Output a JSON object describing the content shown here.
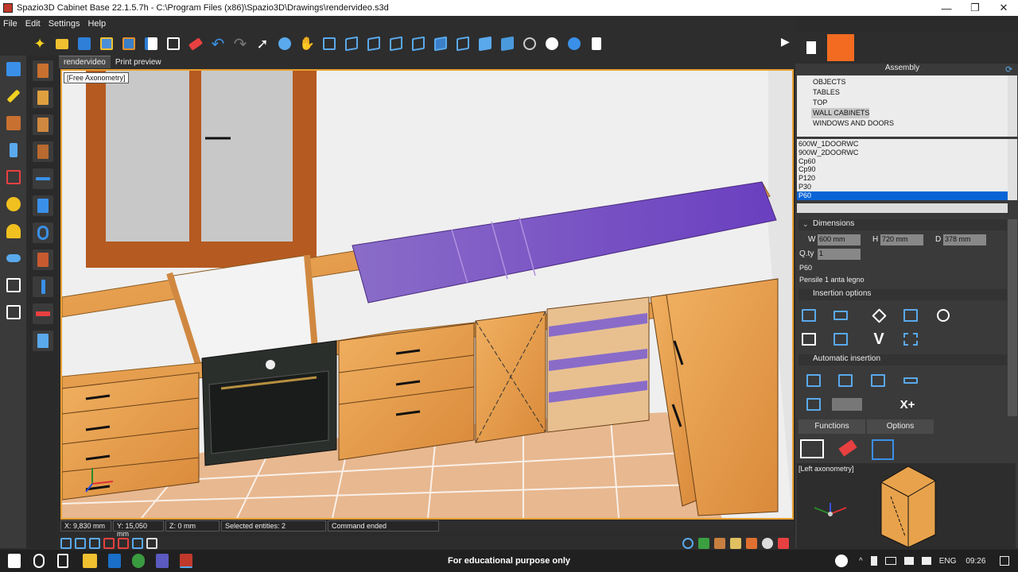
{
  "window": {
    "title": "Spazio3D Cabinet Base 22.1.5.7h - C:\\Program Files (x86)\\Spazio3D\\Drawings\\rendervideo.s3d",
    "minimize": "—",
    "maximize": "❐",
    "close": "✕"
  },
  "menu": [
    "File",
    "Edit",
    "Settings",
    "Help"
  ],
  "toolbar": {
    "icons": [
      "new-star-icon",
      "open-folder-icon",
      "save-icon",
      "save-as-icon",
      "save-copy-icon",
      "export-icon",
      "copy-icon",
      "erase-icon",
      "undo-icon",
      "redo-icon",
      "select-arrow-icon",
      "rotate-view-icon",
      "pan-hand-icon",
      "zoom-extents-icon",
      "view-front-icon",
      "view-back-icon",
      "view-left-icon",
      "view-right-icon",
      "view-top-icon",
      "view-bottom-icon",
      "view-iso-icon",
      "view-iso2-icon",
      "wireframe-globe-icon",
      "shaded-sphere-icon",
      "render-sphere-icon",
      "clipboard-icon"
    ],
    "expand_icon": "▶"
  },
  "tabs": [
    "rendervideo",
    "Print preview"
  ],
  "viewport": {
    "label": "[Free Axonometry]"
  },
  "status": {
    "x": "X: 9,830 mm",
    "y": "Y: 15,050 mm",
    "z": "Z: 0 mm",
    "selected": "Selected entities: 2",
    "command": "Command ended"
  },
  "right_panel": {
    "assembly_title": "Assembly",
    "tree": [
      "OBJECTS",
      "TABLES",
      "TOP",
      "WALL CABINETS",
      "WINDOWS AND DOORS"
    ],
    "tree_selected": "WALL CABINETS",
    "items": [
      "600W_1DOORWC",
      "900W_2DOORWC",
      "Cp60",
      "Cp90",
      "P120",
      "P30",
      "P60"
    ],
    "item_selected": "P60",
    "dimensions": {
      "header": "Dimensions",
      "w_label": "W",
      "w_value": "600 mm",
      "h_label": "H",
      "h_value": "720 mm",
      "d_label": "D",
      "d_value": "378 mm",
      "qty_label": "Q.ty",
      "qty_value": "1",
      "code": "P60",
      "description": "Pensile 1 anta legno"
    },
    "insertion_header": "Insertion options",
    "automatic_header": "Automatic insertion",
    "functions_tab": "Functions",
    "options_tab": "Options",
    "preview_label": "[Left axonometry]"
  },
  "taskbar": {
    "notice": "For educational purpose only",
    "lang": "ENG",
    "time": "09:26"
  },
  "colors": {
    "accent_orange": "#f26b21",
    "selection_blue": "#0a64d6",
    "viewport_border": "#e8a030",
    "icon_blue": "#5aa9ec",
    "wood": "#e8a24c",
    "worktop_purple": "#7a4fc8"
  }
}
